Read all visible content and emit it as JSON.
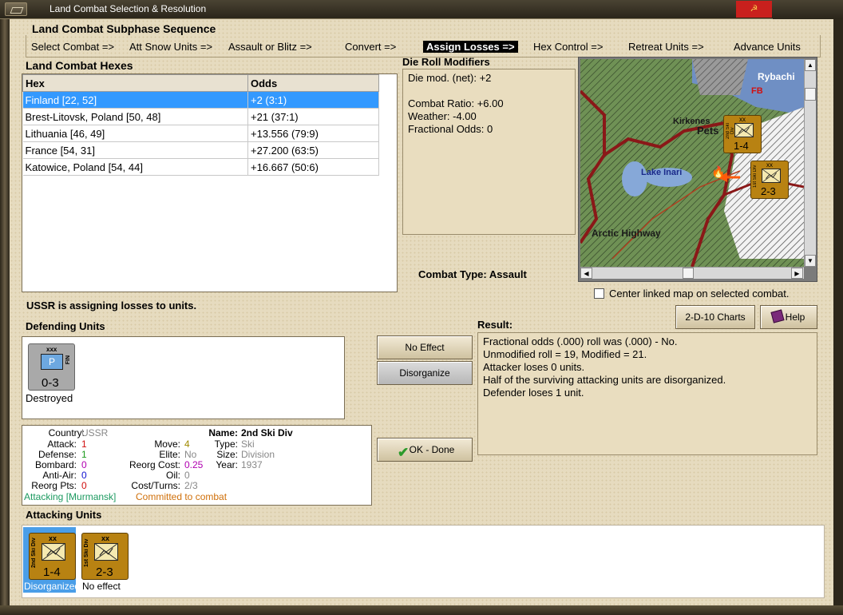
{
  "window": {
    "title": "Land Combat Selection & Resolution",
    "close_glyph": "☭"
  },
  "sequence": {
    "heading": "Land Combat Subphase Sequence",
    "steps": [
      "Select Combat =>",
      "Att Snow Units =>",
      "Assault or Blitz =>",
      "Convert =>",
      "Assign Losses =>",
      "Hex Control =>",
      "Retreat Units =>",
      "Advance Units"
    ],
    "active_index": 4
  },
  "hexes": {
    "heading": "Land Combat Hexes",
    "columns": [
      "Hex",
      "Odds"
    ],
    "rows": [
      {
        "hex": "Finland [22, 52]",
        "odds": "+2 (3:1)"
      },
      {
        "hex": "Brest-Litovsk, Poland [50, 48]",
        "odds": "+21 (37:1)"
      },
      {
        "hex": "Lithuania [46, 49]",
        "odds": "+13.556 (79:9)"
      },
      {
        "hex": "France [54, 31]",
        "odds": "+27.200 (63:5)"
      },
      {
        "hex": "Katowice, Poland [54, 44]",
        "odds": "+16.667 (50:6)"
      }
    ],
    "selected_index": 0
  },
  "modifiers": {
    "heading": "Die Roll Modifiers",
    "lines": [
      "Die mod. (net): +2",
      "",
      "Combat Ratio: +6.00",
      "Weather: -4.00",
      "Fractional Odds: 0"
    ]
  },
  "combat_type": {
    "label": "Combat Type:",
    "value": "Assault"
  },
  "map": {
    "labels": [
      "Rybachi",
      "FB",
      "Kirkenes",
      "Pets",
      "Lake Inari",
      "Arctic Highway"
    ],
    "units": [
      {
        "side": "2nd Ski Div",
        "size": "xx",
        "value": "1-4"
      },
      {
        "side": "1st Ski Div",
        "size": "xx",
        "value": "2-3"
      }
    ],
    "center_checkbox_label": "Center linked map on selected combat.",
    "center_checked": false
  },
  "status_message": "USSR is assigning losses to units.",
  "defending": {
    "heading": "Defending Units",
    "units": [
      {
        "size": "xxx",
        "symbol": "P",
        "side": "FIN",
        "value": "0-3",
        "caption": "Destroyed"
      }
    ]
  },
  "buttons": {
    "no_effect": "No Effect",
    "disorganize": "Disorganize",
    "ok_done": "OK - Done",
    "charts": "2-D-10 Charts",
    "help": "Help"
  },
  "result": {
    "heading": "Result:",
    "lines": [
      "Fractional odds (.000) roll was (.000)  - No.",
      "Unmodified roll = 19, Modified = 21.",
      "Attacker loses 0 units.",
      "Half of the surviving attacking units are disorganized.",
      "Defender loses 1 unit."
    ]
  },
  "unit_info": {
    "country_label": "Country:",
    "country": "USSR",
    "attack_label": "Attack:",
    "attack": "1",
    "defense_label": "Defense:",
    "defense": "1",
    "bombard_label": "Bombard:",
    "bombard": "0",
    "antiair_label": "Anti-Air:",
    "antiair": "0",
    "reorgpts_label": "Reorg Pts:",
    "reorgpts": "0",
    "move_label": "Move:",
    "move": "4",
    "elite_label": "Elite:",
    "elite": "No",
    "reorgcost_label": "Reorg Cost:",
    "reorgcost": "0.25",
    "oil_label": "Oil:",
    "oil": "0",
    "costturns_label": "Cost/Turns:",
    "costturns": "2/3",
    "name_label": "Name:",
    "name": "2nd Ski Div",
    "type_label": "Type:",
    "type": "Ski",
    "size_label": "Size:",
    "size": "Division",
    "year_label": "Year:",
    "year": "1937",
    "attacking_text": "Attacking [Murmansk]",
    "committed_text": "Committed to combat",
    "colors": {
      "attack": "#d01010",
      "defense": "#1c9a1c",
      "bombard": "#b000b0",
      "antiair": "#1010d0",
      "reorg": "#d01010",
      "attacking": "#1c9a60",
      "committed": "#d0700a"
    }
  },
  "attacking": {
    "heading": "Attacking Units",
    "units": [
      {
        "side": "2nd Ski Div",
        "size": "xx",
        "value": "1-4",
        "caption": "Disorganized",
        "selected": true
      },
      {
        "side": "1st Ski Div",
        "size": "xx",
        "value": "2-3",
        "caption": "No effect",
        "selected": false
      }
    ]
  }
}
